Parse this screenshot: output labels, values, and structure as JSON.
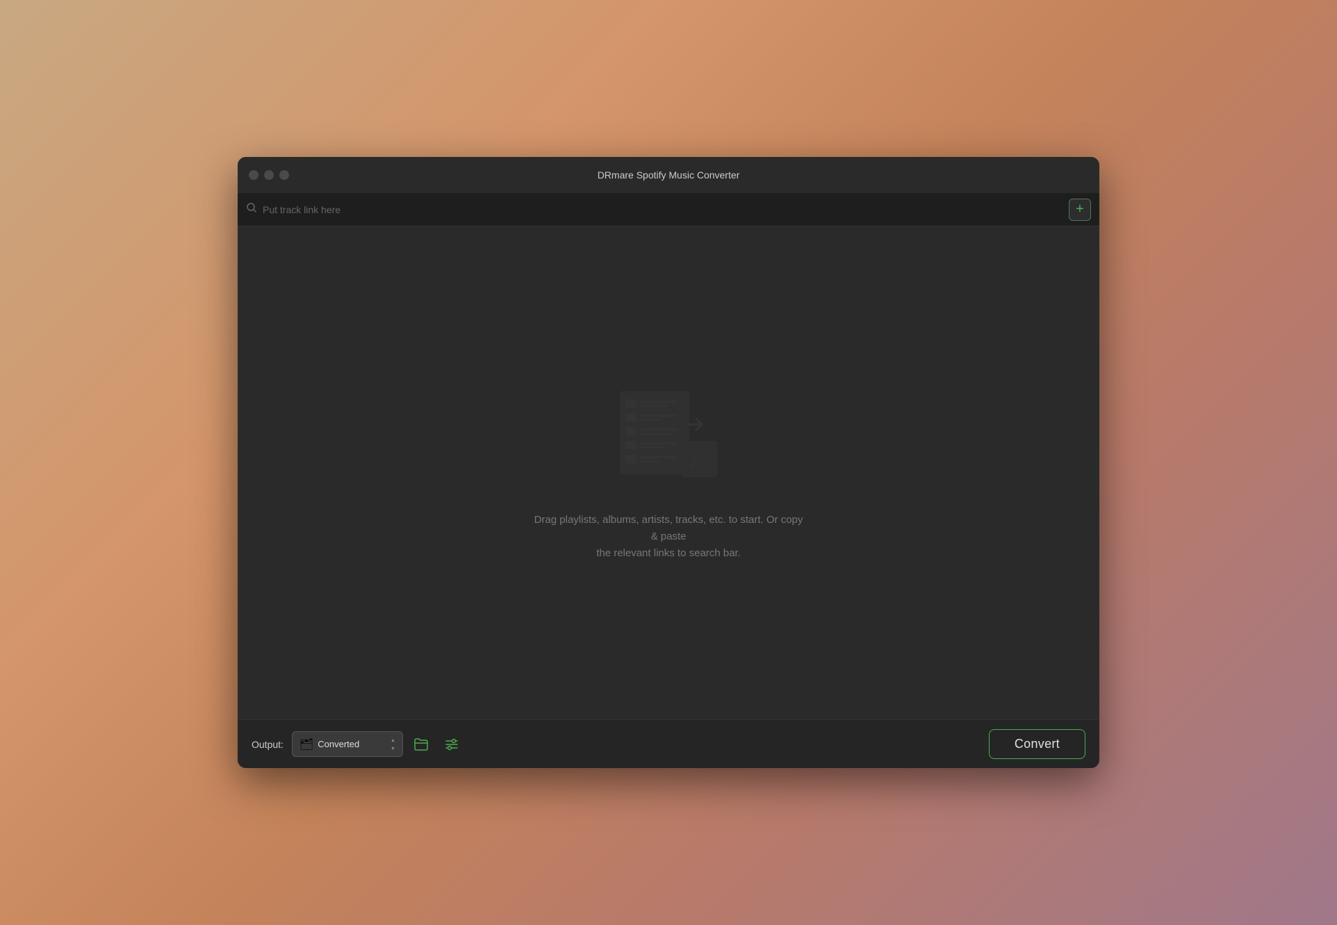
{
  "window": {
    "title": "DRmare Spotify Music Converter",
    "controls": {
      "close_label": "close",
      "minimize_label": "minimize",
      "maximize_label": "maximize"
    }
  },
  "search": {
    "placeholder": "Put track link here"
  },
  "add_button": {
    "label": "+"
  },
  "empty_state": {
    "description_line1": "Drag playlists, albums, artists, tracks, etc. to start. Or copy & paste",
    "description_line2": "the relevant links to search bar."
  },
  "bottom_bar": {
    "output_label": "Output:",
    "output_folder_emoji": "🗂",
    "output_value": "Converted",
    "open_folder_label": "📂",
    "list_settings_label": "☰",
    "convert_button_label": "Convert"
  }
}
